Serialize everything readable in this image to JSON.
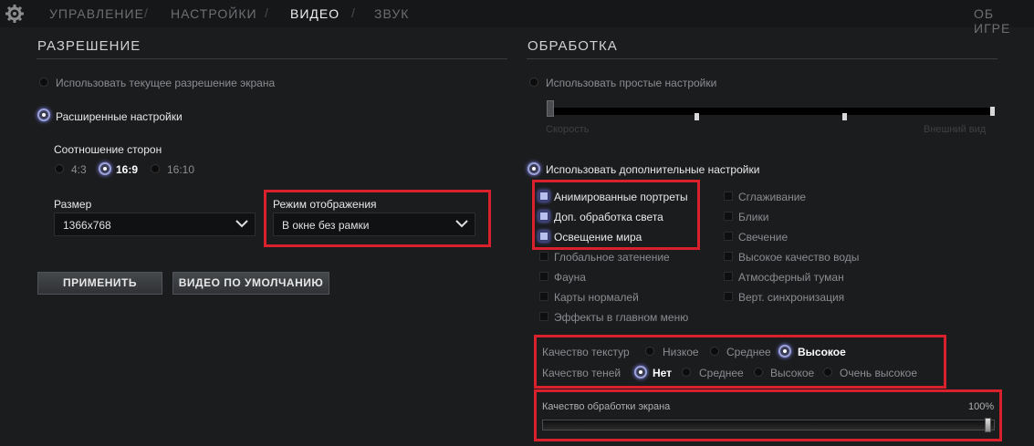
{
  "nav": {
    "tabs": [
      "УПРАВЛЕНИЕ",
      "НАСТРОЙКИ",
      "ВИДЕО",
      "ЗВУК"
    ],
    "separator": "/",
    "about": "ОБ ИГРЕ"
  },
  "resolution": {
    "title": "РАЗРЕШЕНИЕ",
    "use_current": "Использовать текущее разрешение экрана",
    "advanced": "Расширенные настройки",
    "aspect_label": "Соотношение сторон",
    "aspect_options": [
      "4:3",
      "16:9",
      "16:10"
    ],
    "aspect_selected": "16:9",
    "size_label": "Размер",
    "size_value": "1366x768",
    "mode_label": "Режим отображения",
    "mode_value": "В окне без рамки",
    "apply": "ПРИМЕНИТЬ",
    "defaults": "ВИДЕО ПО УМОЛЧАНИЮ"
  },
  "rendering": {
    "title": "ОБРАБОТКА",
    "simple": "Использовать простые настройки",
    "speed": "Скорость",
    "appearance": "Внешний вид",
    "advanced": "Использовать дополнительные настройки",
    "checks_left": [
      {
        "label": "Анимированные портреты",
        "on": true
      },
      {
        "label": "Доп. обработка света",
        "on": true
      },
      {
        "label": "Освещение мира",
        "on": true
      },
      {
        "label": "Глобальное затенение",
        "on": false
      },
      {
        "label": "Фауна",
        "on": false
      },
      {
        "label": "Карты нормалей",
        "on": false
      },
      {
        "label": "Эффекты в главном меню",
        "on": false
      }
    ],
    "checks_right": [
      {
        "label": "Сглаживание",
        "on": false
      },
      {
        "label": "Блики",
        "on": false
      },
      {
        "label": "Свечение",
        "on": false
      },
      {
        "label": "Высокое качество воды",
        "on": false
      },
      {
        "label": "Атмосферный туман",
        "on": false
      },
      {
        "label": "Верт. синхронизация",
        "on": false
      }
    ],
    "texture_label": "Качество текстур",
    "texture_options": [
      "Низкое",
      "Среднее",
      "Высокое"
    ],
    "texture_selected": "Высокое",
    "shadow_label": "Качество теней",
    "shadow_options": [
      "Нет",
      "Среднее",
      "Высокое",
      "Очень высокое"
    ],
    "shadow_selected": "Нет",
    "screen_quality_label": "Качество обработки экрана",
    "screen_quality_value": "100%",
    "screen_quality_level": 1.0
  }
}
